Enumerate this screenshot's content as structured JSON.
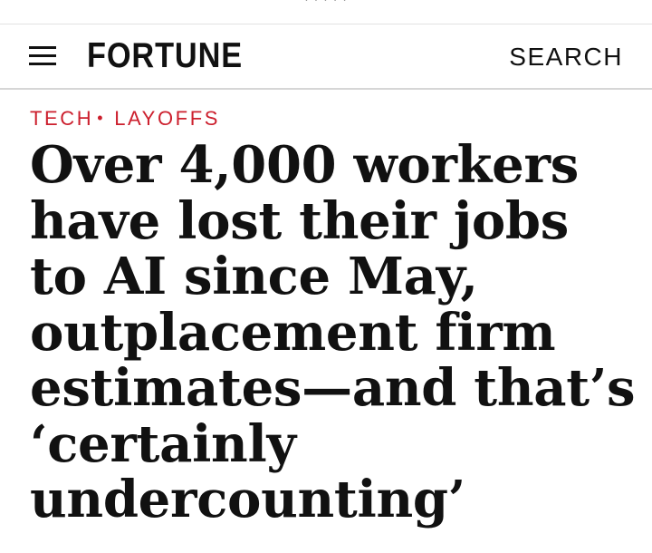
{
  "nav": {
    "menu_icon": "hamburger-menu-icon",
    "logo_text": "FORTUNE",
    "search_label": "SEARCH"
  },
  "article": {
    "breadcrumb": {
      "section": "TECH",
      "separator": "•",
      "topic": "LAYOFFS"
    },
    "headline": "Over 4,000 workers have lost their jobs to AI since May, outplacement firm estimates—and that’s ‘certainly undercounting’"
  },
  "colors": {
    "accent": "#cc1f2d",
    "text": "#111111",
    "background": "#ffffff",
    "divider": "#d6d6d6"
  }
}
